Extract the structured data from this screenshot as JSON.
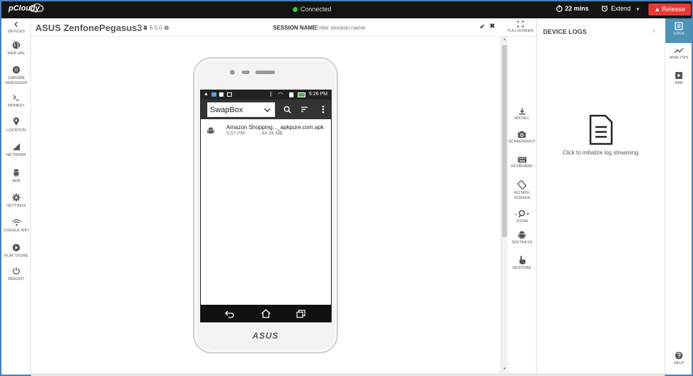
{
  "topbar": {
    "brand": "pCloudy",
    "status": "Connected",
    "timer": "22 mins",
    "extend_label": "Extend",
    "release_label": "Release"
  },
  "left_nav": [
    {
      "name": "devices",
      "label": "DEVICES",
      "icon": "chevron-left-icon"
    },
    {
      "name": "web-url",
      "label": "WEB URL",
      "icon": "globe-icon"
    },
    {
      "name": "chrome-debugger",
      "label": "CHROME DEBUGGER",
      "icon": "chrome-icon"
    },
    {
      "name": "monkey",
      "label": "MONKEY",
      "icon": "terminal-icon"
    },
    {
      "name": "location",
      "label": "LOCATION",
      "icon": "pin-icon"
    },
    {
      "name": "network",
      "label": "NETWORK",
      "icon": "signal-icon"
    },
    {
      "name": "adb",
      "label": "ADB",
      "icon": "android-icon"
    },
    {
      "name": "settings",
      "label": "SETTINGS",
      "icon": "gear-icon"
    },
    {
      "name": "toggle-wifi",
      "label": "TOGGLE WIFI",
      "icon": "wifi-icon"
    },
    {
      "name": "play-store",
      "label": "PLAY STORE",
      "icon": "play-icon"
    },
    {
      "name": "reboot",
      "label": "REBOOT",
      "icon": "power-icon"
    }
  ],
  "session": {
    "device_name": "ASUS ZenfonePegasus3",
    "android_version": "6.0.0",
    "session_label": "SESSION NAME",
    "session_placeholder": "Enter session name",
    "fullscreen_label": "FULLSCREEN"
  },
  "tools": [
    {
      "name": "install",
      "label": "INSTALL",
      "icon": "download-icon"
    },
    {
      "name": "screenshot",
      "label": "SCREENSHOT",
      "icon": "camera-icon"
    },
    {
      "name": "keyboard",
      "label": "KEYBOARD",
      "icon": "keyboard-icon"
    },
    {
      "name": "rotate-screen",
      "label": "ROTATE SCREEN",
      "icon": "rotate-icon"
    },
    {
      "name": "zoom",
      "label": "ZOOM",
      "icon": "magnifier-icon"
    },
    {
      "name": "softkeys",
      "label": "SOFTKEYS",
      "icon": "android-icon"
    },
    {
      "name": "gesture",
      "label": "GESTURE",
      "icon": "hand-icon"
    }
  ],
  "phone": {
    "clock": "6:26 PM",
    "spinner_value": "SwapBox",
    "file": {
      "name": "Amazon Shopping..._apkpure.com.apk",
      "time": "5:57 PM",
      "size": "44.34 MB"
    },
    "brand": "ASUS"
  },
  "logs_panel": {
    "title": "DEVICE LOGS",
    "message": "Click to initialize log streaming."
  },
  "right_nav": [
    {
      "name": "logs",
      "label": "LOGS",
      "icon": "logs-icon",
      "active": true
    },
    {
      "name": "analysis",
      "label": "ANALYSIS",
      "icon": "line-chart-icon",
      "active": false
    },
    {
      "name": "aar",
      "label": "AAR",
      "icon": "video-icon",
      "active": false
    },
    {
      "name": "help",
      "label": "HELP",
      "icon": "help-icon",
      "active": false
    }
  ],
  "colors": {
    "topbar": "#141414",
    "accent": "#4e92b8",
    "release": "#e53935",
    "connected": "#3ec03e"
  }
}
